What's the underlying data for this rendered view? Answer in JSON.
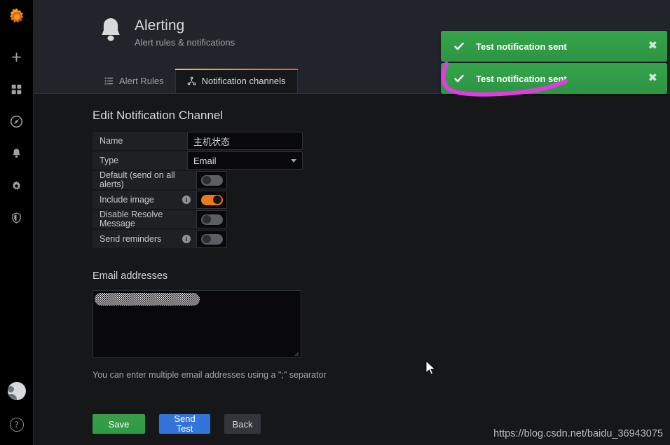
{
  "app": {
    "brand_icon": "grafana-logo-icon",
    "accent_orange": "#eb7b18",
    "bg": "#161719",
    "panel_bg": "#21242b"
  },
  "sidebar": {
    "top_items": [
      {
        "name": "create-add",
        "icon": "plus-icon"
      },
      {
        "name": "dashboards",
        "icon": "dashboards-grid-icon"
      },
      {
        "name": "explore",
        "icon": "compass-icon"
      },
      {
        "name": "alerting",
        "icon": "bell-icon"
      },
      {
        "name": "configuration",
        "icon": "gear-icon"
      },
      {
        "name": "server-admin",
        "icon": "shield-icon"
      }
    ],
    "bottom_items": [
      {
        "name": "user-profile",
        "icon": "avatar-icon"
      },
      {
        "name": "help",
        "icon": "question-circle-icon",
        "glyph": "?"
      }
    ]
  },
  "header": {
    "icon": "bell-icon",
    "title": "Alerting",
    "subtitle": "Alert rules & notifications"
  },
  "tabs": [
    {
      "label": "Alert Rules",
      "icon": "list-icon",
      "active": false
    },
    {
      "label": "Notification channels",
      "icon": "share-nodes-icon",
      "active": true
    }
  ],
  "main": {
    "section_title": "Edit Notification Channel",
    "fields": [
      {
        "label": "Name",
        "type": "text",
        "value": "主机状态"
      },
      {
        "label": "Type",
        "type": "select",
        "value": "Email"
      }
    ],
    "switches": [
      {
        "label": "Default (send on all alerts)",
        "info": false,
        "on": false
      },
      {
        "label": "Include image",
        "info": true,
        "on": true
      },
      {
        "label": "Disable Resolve Message",
        "info": false,
        "on": false
      },
      {
        "label": "Send reminders",
        "info": true,
        "on": false
      }
    ],
    "email": {
      "label": "Email addresses",
      "value": "",
      "redacted": true,
      "hint": "You can enter multiple email addresses using a \";\" separator"
    },
    "buttons": [
      {
        "name": "save-button",
        "label": "Save",
        "style": "green"
      },
      {
        "name": "send-test-button",
        "label_line1": "Send",
        "label_line2": "Test",
        "style": "blue"
      },
      {
        "name": "back-button",
        "label": "Back",
        "style": "grey"
      }
    ]
  },
  "toasts": [
    {
      "icon": "check-icon",
      "message": "Test notification sent",
      "close": "✖"
    },
    {
      "icon": "check-icon",
      "message": "Test notification sent",
      "close": "✖"
    }
  ],
  "annotation": {
    "color": "#e040f0",
    "shape": "hand-drawn-underline-hook"
  },
  "watermark": "https://blog.csdn.net/baidu_36943075"
}
